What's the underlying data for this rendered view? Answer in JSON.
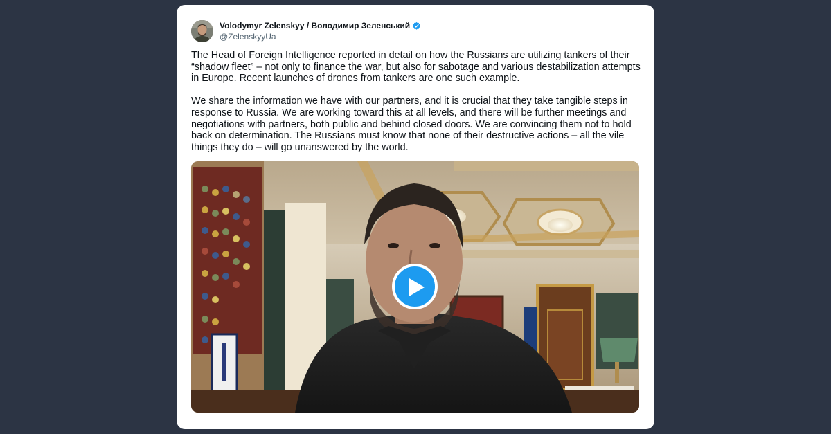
{
  "post": {
    "author_name": "Volodymyr Zelenskyy / Володимир Зеленський",
    "author_handle": "@ZelenskyyUa",
    "verified": true,
    "paragraph_1": "The Head of Foreign Intelligence reported in detail on how the Russians are utilizing tankers of their “shadow fleet” – not only to finance the war, but also for sabotage and various destabilization attempts in Europe. Recent launches of drones from tankers are one such example.",
    "paragraph_2": "We share the information we have with our partners, and it is crucial that they take tangible steps in response to Russia. We are working toward this at all levels, and there will be further meetings and negotiations with partners, both public and behind closed doors. We are convincing them not to hold back on determination. The Russians must know that none of their destructive actions – all the vile things they do – will go unanswered by the world."
  },
  "media": {
    "type": "video",
    "play_icon": "play-icon"
  },
  "colors": {
    "page_background": "#2c3444",
    "card_background": "#ffffff",
    "play_button": "#1d9bf0",
    "verified_badge": "#1d9bf0",
    "handle_text": "#536471"
  }
}
